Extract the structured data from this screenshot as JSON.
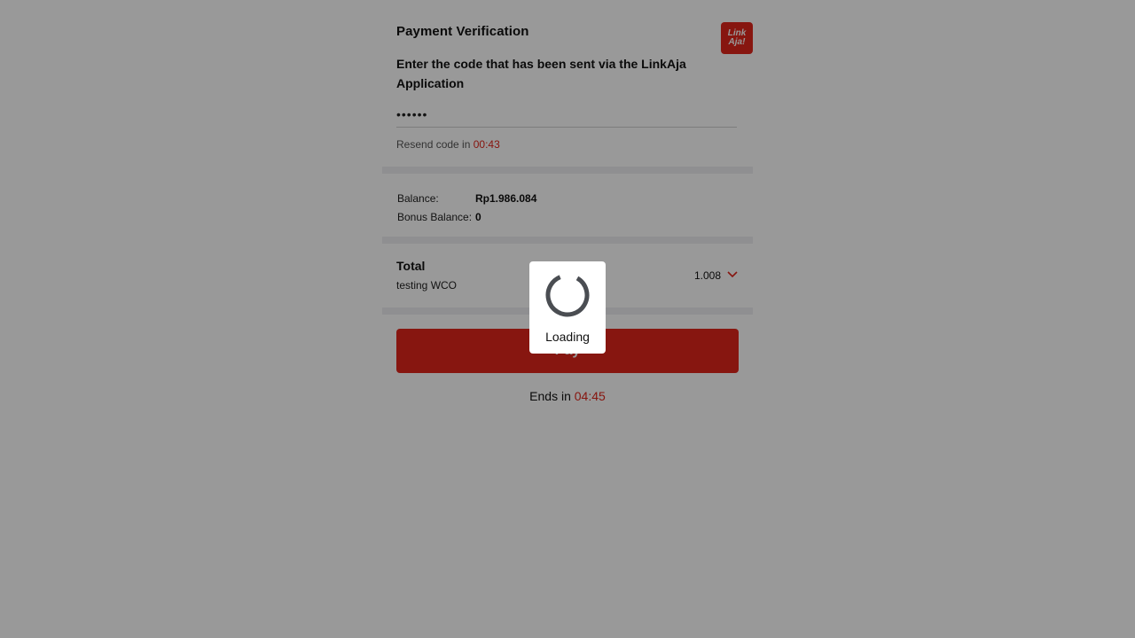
{
  "header": {
    "title": "Payment Verification",
    "logo": {
      "line1": "Link",
      "line2": "Aja!",
      "color": "#e1251b",
      "icon": "linkaja-logo"
    }
  },
  "verification": {
    "instruction": "Enter the code that has been sent via the LinkAja Application",
    "code_value": "••••••",
    "resend_prefix": "Resend code in ",
    "resend_timer": "00:43"
  },
  "balance": {
    "rows": [
      {
        "label": "Balance:",
        "value": "Rp1.986.084"
      },
      {
        "label": "Bonus Balance:",
        "value": "0"
      }
    ]
  },
  "total": {
    "label": "Total",
    "description": "testing WCO",
    "amount": "1.008",
    "expand_icon": "chevron-down-icon"
  },
  "actions": {
    "pay_label": "Pay"
  },
  "session": {
    "ends_prefix": "Ends in ",
    "ends_timer": "04:45"
  },
  "loading": {
    "text": "Loading"
  },
  "colors": {
    "accent": "#e1251b",
    "divider": "#eeeef2",
    "overlay": "rgba(0,0,0,0.40)"
  }
}
